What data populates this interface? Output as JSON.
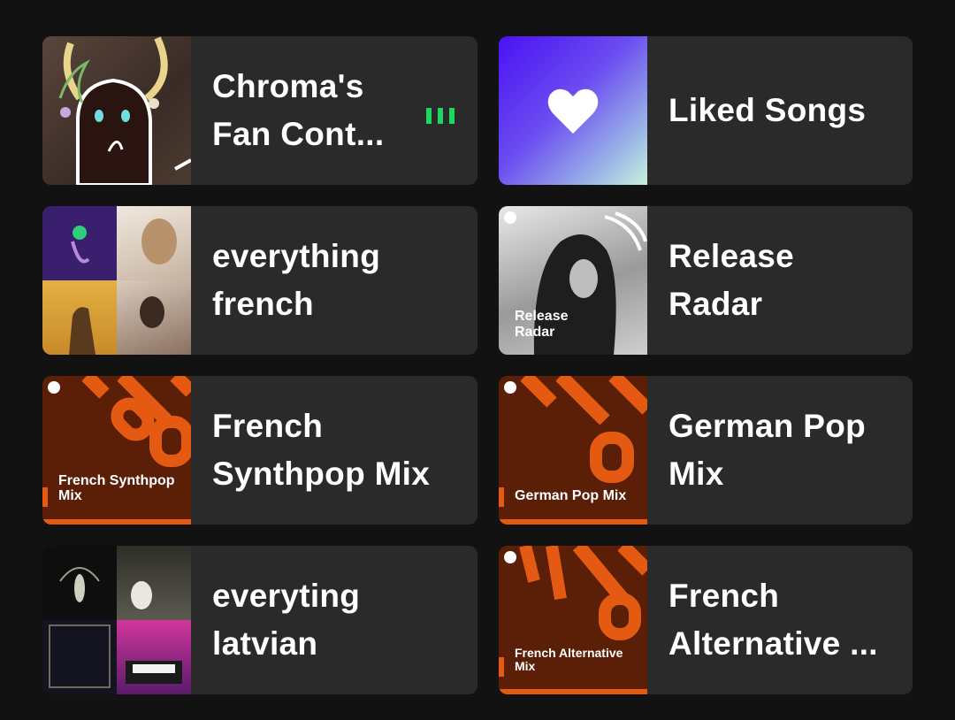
{
  "cards": [
    {
      "title_line1": "Chroma's",
      "title_line2": "Fan Cont...",
      "art": "chroma-fan-content-artwork",
      "playing": true
    },
    {
      "title_line1": "Liked Songs",
      "title_line2": "",
      "art": "heart-icon"
    },
    {
      "title_line1": "everything",
      "title_line2": "french",
      "art": "playlist-collage"
    },
    {
      "title_line1": "Release",
      "title_line2": "Radar",
      "art": "release-radar-cover",
      "art_caption_line1": "Release",
      "art_caption_line2": "Radar"
    },
    {
      "title_line1": "French",
      "title_line2": "Synthpop Mix",
      "art": "mix-cover",
      "art_caption_line1": "French Synthpop",
      "art_caption_line2": "Mix"
    },
    {
      "title_line1": "German Pop",
      "title_line2": "Mix",
      "art": "mix-cover",
      "art_caption_line1": "German Pop Mix",
      "art_caption_line2": ""
    },
    {
      "title_line1": "everyting",
      "title_line2": "latvian",
      "art": "playlist-collage"
    },
    {
      "title_line1": "French",
      "title_line2": "Alternative ...",
      "art": "mix-cover",
      "art_caption_line1": "French Alternative",
      "art_caption_line2": "Mix"
    }
  ],
  "colors": {
    "background": "#121212",
    "card": "#2a2a2a",
    "accent_green": "#1ed760",
    "mix_orange": "#e55a12",
    "mix_brown": "#5a1f06"
  }
}
